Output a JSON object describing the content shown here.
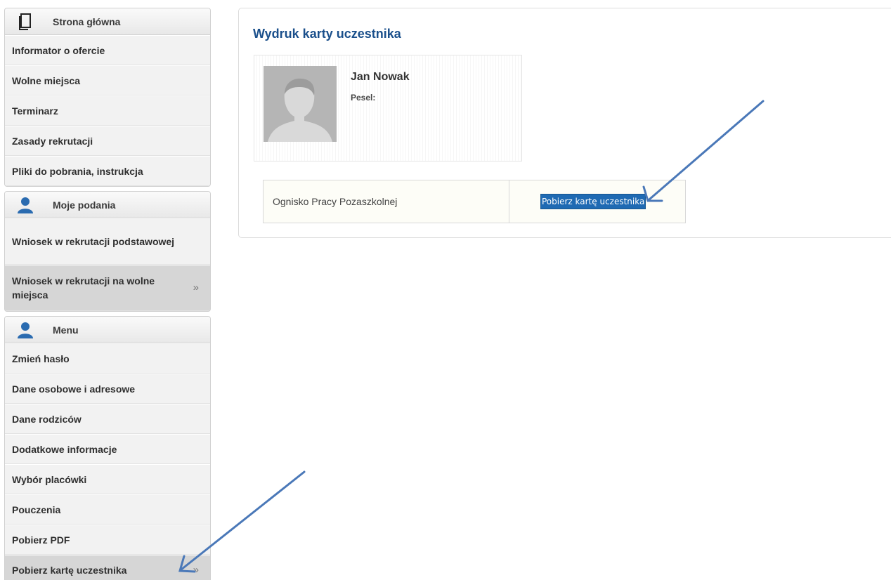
{
  "sidebar": {
    "panels": [
      {
        "title": "Strona główna",
        "icon": "document-icon",
        "items": [
          {
            "label": "Informator o ofercie"
          },
          {
            "label": "Wolne miejsca"
          },
          {
            "label": "Terminarz"
          },
          {
            "label": "Zasady rekrutacji"
          },
          {
            "label": "Pliki do pobrania, instrukcja"
          }
        ]
      },
      {
        "title": "Moje podania",
        "icon": "user-icon",
        "items": [
          {
            "label": "Wniosek w rekrutacji podstawowej"
          },
          {
            "label": "Wniosek w rekrutacji na wolne miejsca",
            "chevron": "»"
          }
        ]
      },
      {
        "title": "Menu",
        "icon": "user-icon",
        "items": [
          {
            "label": "Zmień hasło"
          },
          {
            "label": "Dane osobowe i adresowe"
          },
          {
            "label": "Dane rodziców"
          },
          {
            "label": "Dodatkowe informacje"
          },
          {
            "label": "Wybór placówki"
          },
          {
            "label": "Pouczenia"
          },
          {
            "label": "Pobierz PDF"
          },
          {
            "label": "Pobierz kartę uczestnika",
            "chevron": "»"
          }
        ]
      }
    ]
  },
  "main": {
    "title": "Wydruk karty uczestnika",
    "profile": {
      "name": "Jan Nowak",
      "pesel_label": "Pesel:"
    },
    "table": {
      "institution": "Ognisko Pracy Pozaszkolnej",
      "button_label": "Pobierz kartę uczestnika"
    }
  },
  "colors": {
    "title": "#1a4f8b",
    "button": "#1f6ab3",
    "icon": "#2a6bb0",
    "arrow": "#4a78b8"
  }
}
